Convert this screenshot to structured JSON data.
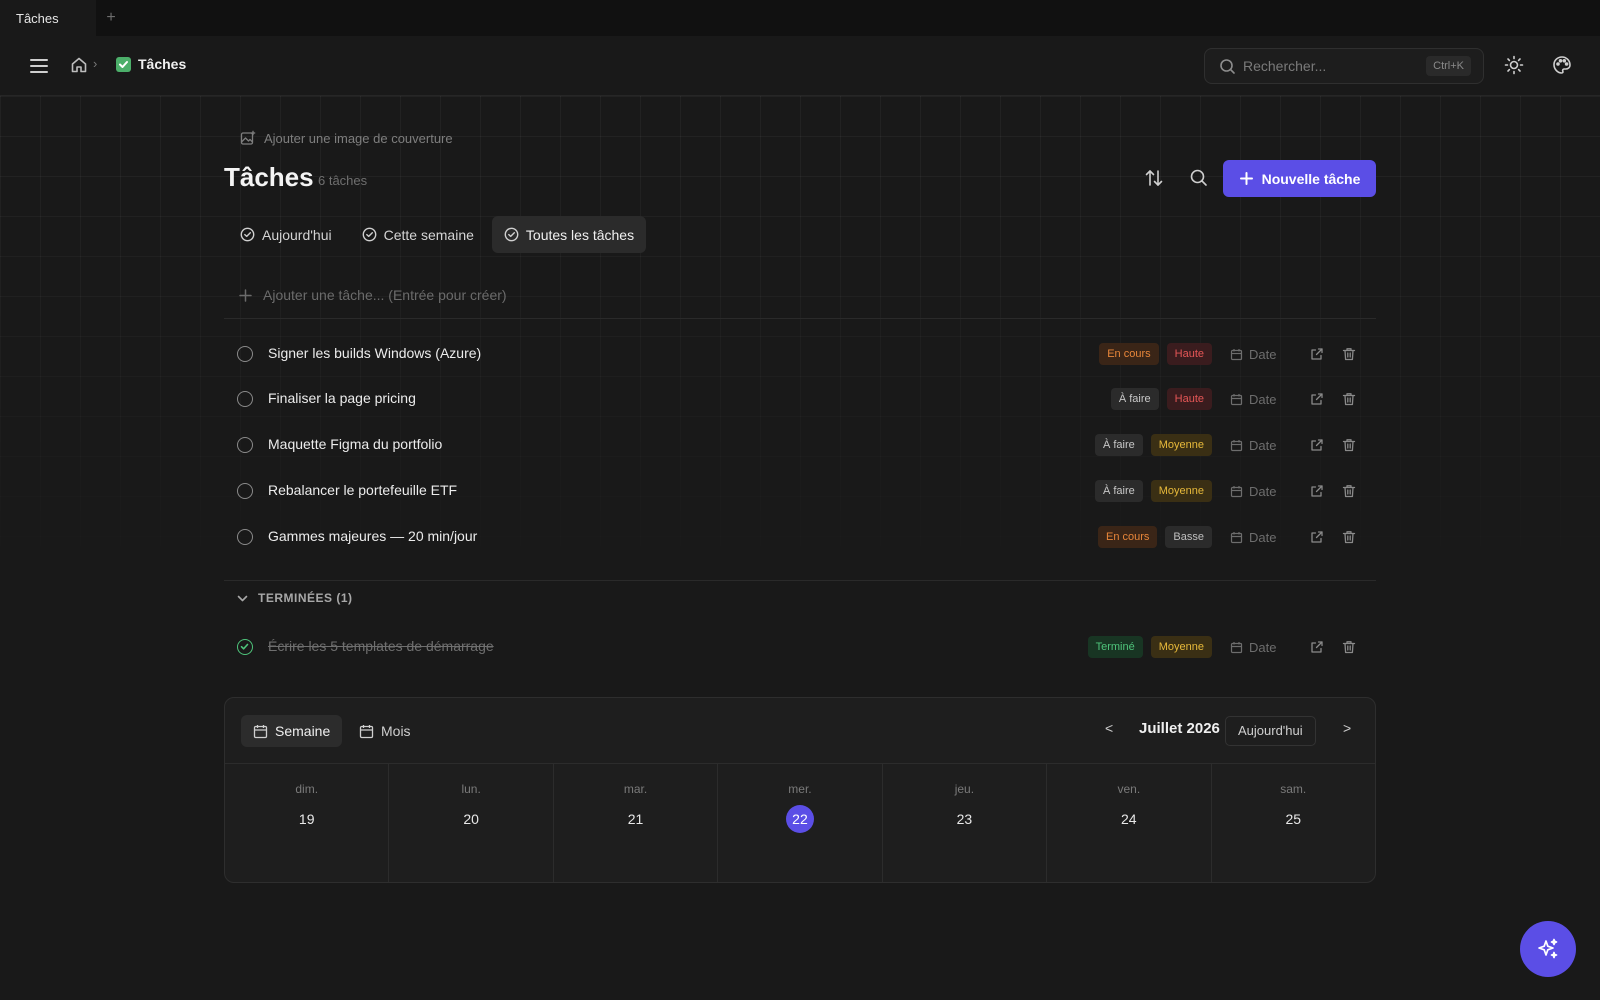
{
  "browser": {
    "tab_title": "Tâches",
    "new_tab": "+"
  },
  "header": {
    "breadcrumb_sep": "›",
    "breadcrumb_title": "Tâches",
    "search_placeholder": "Rechercher...",
    "search_shortcut": "Ctrl+K"
  },
  "page": {
    "cover_link": "Ajouter une image de couverture",
    "title": "Tâches",
    "task_count": "6 tâches",
    "new_task_label": "Nouvelle tâche",
    "add_task_placeholder": "Ajouter une tâche... (Entrée pour créer)"
  },
  "filters": [
    {
      "label": "Aujourd'hui",
      "active": false
    },
    {
      "label": "Cette semaine",
      "active": false
    },
    {
      "label": "Toutes les tâches",
      "active": true
    }
  ],
  "tasks": [
    {
      "title": "Signer les builds Windows (Azure)",
      "status": "En cours",
      "priority": "Haute",
      "date": "Date",
      "done": false
    },
    {
      "title": "Finaliser la page pricing",
      "status": "À faire",
      "priority": "Haute",
      "date": "Date",
      "done": false
    },
    {
      "title": "Maquette Figma du portfolio",
      "status": "À faire",
      "priority": "Moyenne",
      "date": "Date",
      "done": false
    },
    {
      "title": "Rebalancer le portefeuille ETF",
      "status": "À faire",
      "priority": "Moyenne",
      "date": "Date",
      "done": false
    },
    {
      "title": "Gammes majeures — 20 min/jour",
      "status": "En cours",
      "priority": "Basse",
      "date": "Date",
      "done": false
    }
  ],
  "completed": {
    "header": "TERMINÉES (1)",
    "tasks": [
      {
        "title": "Écrire les 5 templates de démarrage",
        "status": "Terminé",
        "priority": "Moyenne",
        "date": "Date",
        "done": true
      }
    ]
  },
  "calendar": {
    "view_week": "Semaine",
    "view_month": "Mois",
    "prev": "<",
    "next": ">",
    "month_label": "Juillet 2026",
    "today_label": "Aujourd'hui",
    "days": [
      {
        "dow": "dim.",
        "num": "19",
        "today": false
      },
      {
        "dow": "lun.",
        "num": "20",
        "today": false
      },
      {
        "dow": "mar.",
        "num": "21",
        "today": false
      },
      {
        "dow": "mer.",
        "num": "22",
        "today": true
      },
      {
        "dow": "jeu.",
        "num": "23",
        "today": false
      },
      {
        "dow": "ven.",
        "num": "24",
        "today": false
      },
      {
        "dow": "sam.",
        "num": "25",
        "today": false
      }
    ]
  },
  "colors": {
    "accent": "#5b4ee6",
    "background": "#191919",
    "success": "#4ec37a",
    "warning": "#e7b93a",
    "danger": "#e55656",
    "orange": "#e8863a"
  },
  "icons": {
    "menu": "hamburger-icon",
    "home": "home-icon",
    "search": "search-icon",
    "theme": "sun-icon",
    "palette": "palette-icon",
    "sort": "sort-icon",
    "image": "image-add-icon",
    "assistant": "sparkles-icon"
  }
}
